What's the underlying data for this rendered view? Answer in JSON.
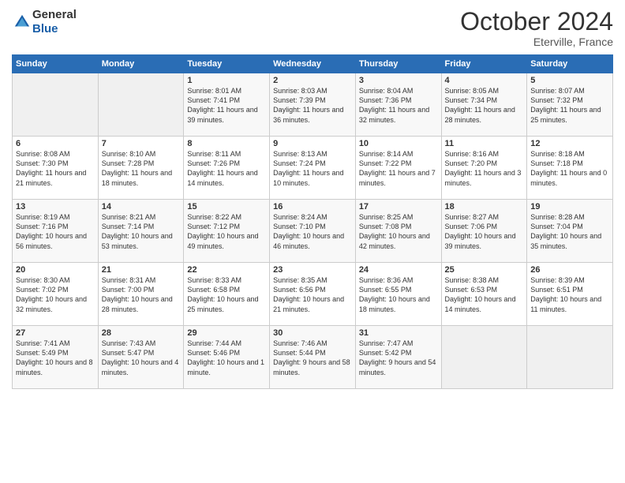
{
  "logo": {
    "general": "General",
    "blue": "Blue"
  },
  "header": {
    "month": "October 2024",
    "location": "Eterville, France"
  },
  "days_of_week": [
    "Sunday",
    "Monday",
    "Tuesday",
    "Wednesday",
    "Thursday",
    "Friday",
    "Saturday"
  ],
  "weeks": [
    [
      {
        "day": "",
        "sunrise": "",
        "sunset": "",
        "daylight": ""
      },
      {
        "day": "",
        "sunrise": "",
        "sunset": "",
        "daylight": ""
      },
      {
        "day": "1",
        "sunrise": "Sunrise: 8:01 AM",
        "sunset": "Sunset: 7:41 PM",
        "daylight": "Daylight: 11 hours and 39 minutes."
      },
      {
        "day": "2",
        "sunrise": "Sunrise: 8:03 AM",
        "sunset": "Sunset: 7:39 PM",
        "daylight": "Daylight: 11 hours and 36 minutes."
      },
      {
        "day": "3",
        "sunrise": "Sunrise: 8:04 AM",
        "sunset": "Sunset: 7:36 PM",
        "daylight": "Daylight: 11 hours and 32 minutes."
      },
      {
        "day": "4",
        "sunrise": "Sunrise: 8:05 AM",
        "sunset": "Sunset: 7:34 PM",
        "daylight": "Daylight: 11 hours and 28 minutes."
      },
      {
        "day": "5",
        "sunrise": "Sunrise: 8:07 AM",
        "sunset": "Sunset: 7:32 PM",
        "daylight": "Daylight: 11 hours and 25 minutes."
      }
    ],
    [
      {
        "day": "6",
        "sunrise": "Sunrise: 8:08 AM",
        "sunset": "Sunset: 7:30 PM",
        "daylight": "Daylight: 11 hours and 21 minutes."
      },
      {
        "day": "7",
        "sunrise": "Sunrise: 8:10 AM",
        "sunset": "Sunset: 7:28 PM",
        "daylight": "Daylight: 11 hours and 18 minutes."
      },
      {
        "day": "8",
        "sunrise": "Sunrise: 8:11 AM",
        "sunset": "Sunset: 7:26 PM",
        "daylight": "Daylight: 11 hours and 14 minutes."
      },
      {
        "day": "9",
        "sunrise": "Sunrise: 8:13 AM",
        "sunset": "Sunset: 7:24 PM",
        "daylight": "Daylight: 11 hours and 10 minutes."
      },
      {
        "day": "10",
        "sunrise": "Sunrise: 8:14 AM",
        "sunset": "Sunset: 7:22 PM",
        "daylight": "Daylight: 11 hours and 7 minutes."
      },
      {
        "day": "11",
        "sunrise": "Sunrise: 8:16 AM",
        "sunset": "Sunset: 7:20 PM",
        "daylight": "Daylight: 11 hours and 3 minutes."
      },
      {
        "day": "12",
        "sunrise": "Sunrise: 8:18 AM",
        "sunset": "Sunset: 7:18 PM",
        "daylight": "Daylight: 11 hours and 0 minutes."
      }
    ],
    [
      {
        "day": "13",
        "sunrise": "Sunrise: 8:19 AM",
        "sunset": "Sunset: 7:16 PM",
        "daylight": "Daylight: 10 hours and 56 minutes."
      },
      {
        "day": "14",
        "sunrise": "Sunrise: 8:21 AM",
        "sunset": "Sunset: 7:14 PM",
        "daylight": "Daylight: 10 hours and 53 minutes."
      },
      {
        "day": "15",
        "sunrise": "Sunrise: 8:22 AM",
        "sunset": "Sunset: 7:12 PM",
        "daylight": "Daylight: 10 hours and 49 minutes."
      },
      {
        "day": "16",
        "sunrise": "Sunrise: 8:24 AM",
        "sunset": "Sunset: 7:10 PM",
        "daylight": "Daylight: 10 hours and 46 minutes."
      },
      {
        "day": "17",
        "sunrise": "Sunrise: 8:25 AM",
        "sunset": "Sunset: 7:08 PM",
        "daylight": "Daylight: 10 hours and 42 minutes."
      },
      {
        "day": "18",
        "sunrise": "Sunrise: 8:27 AM",
        "sunset": "Sunset: 7:06 PM",
        "daylight": "Daylight: 10 hours and 39 minutes."
      },
      {
        "day": "19",
        "sunrise": "Sunrise: 8:28 AM",
        "sunset": "Sunset: 7:04 PM",
        "daylight": "Daylight: 10 hours and 35 minutes."
      }
    ],
    [
      {
        "day": "20",
        "sunrise": "Sunrise: 8:30 AM",
        "sunset": "Sunset: 7:02 PM",
        "daylight": "Daylight: 10 hours and 32 minutes."
      },
      {
        "day": "21",
        "sunrise": "Sunrise: 8:31 AM",
        "sunset": "Sunset: 7:00 PM",
        "daylight": "Daylight: 10 hours and 28 minutes."
      },
      {
        "day": "22",
        "sunrise": "Sunrise: 8:33 AM",
        "sunset": "Sunset: 6:58 PM",
        "daylight": "Daylight: 10 hours and 25 minutes."
      },
      {
        "day": "23",
        "sunrise": "Sunrise: 8:35 AM",
        "sunset": "Sunset: 6:56 PM",
        "daylight": "Daylight: 10 hours and 21 minutes."
      },
      {
        "day": "24",
        "sunrise": "Sunrise: 8:36 AM",
        "sunset": "Sunset: 6:55 PM",
        "daylight": "Daylight: 10 hours and 18 minutes."
      },
      {
        "day": "25",
        "sunrise": "Sunrise: 8:38 AM",
        "sunset": "Sunset: 6:53 PM",
        "daylight": "Daylight: 10 hours and 14 minutes."
      },
      {
        "day": "26",
        "sunrise": "Sunrise: 8:39 AM",
        "sunset": "Sunset: 6:51 PM",
        "daylight": "Daylight: 10 hours and 11 minutes."
      }
    ],
    [
      {
        "day": "27",
        "sunrise": "Sunrise: 7:41 AM",
        "sunset": "Sunset: 5:49 PM",
        "daylight": "Daylight: 10 hours and 8 minutes."
      },
      {
        "day": "28",
        "sunrise": "Sunrise: 7:43 AM",
        "sunset": "Sunset: 5:47 PM",
        "daylight": "Daylight: 10 hours and 4 minutes."
      },
      {
        "day": "29",
        "sunrise": "Sunrise: 7:44 AM",
        "sunset": "Sunset: 5:46 PM",
        "daylight": "Daylight: 10 hours and 1 minute."
      },
      {
        "day": "30",
        "sunrise": "Sunrise: 7:46 AM",
        "sunset": "Sunset: 5:44 PM",
        "daylight": "Daylight: 9 hours and 58 minutes."
      },
      {
        "day": "31",
        "sunrise": "Sunrise: 7:47 AM",
        "sunset": "Sunset: 5:42 PM",
        "daylight": "Daylight: 9 hours and 54 minutes."
      },
      {
        "day": "",
        "sunrise": "",
        "sunset": "",
        "daylight": ""
      },
      {
        "day": "",
        "sunrise": "",
        "sunset": "",
        "daylight": ""
      }
    ]
  ]
}
